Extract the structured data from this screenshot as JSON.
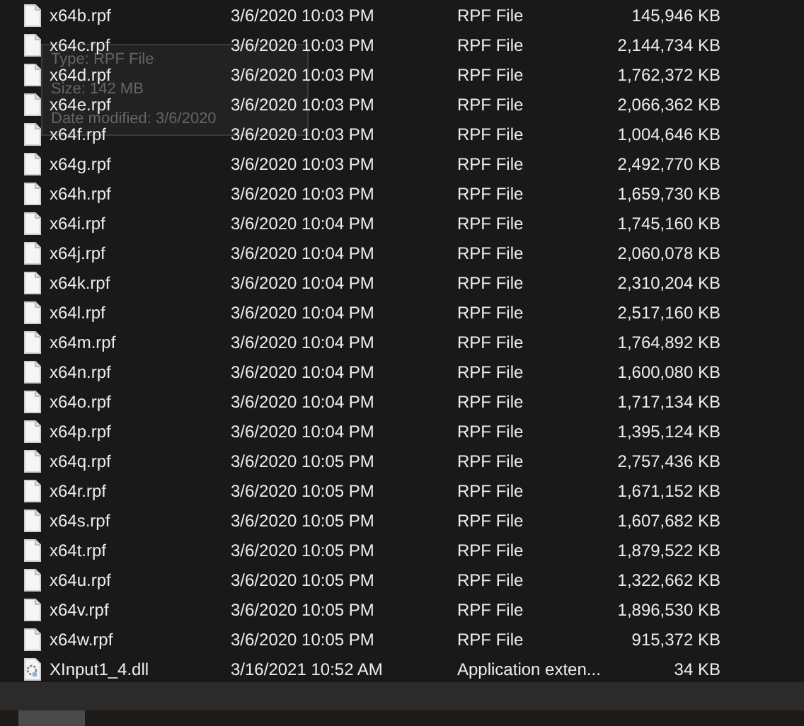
{
  "files": [
    {
      "name": "x64b.rpf",
      "kind": "file",
      "date": "3/6/2020 10:03 PM",
      "type": "RPF File",
      "size": "145,946 KB"
    },
    {
      "name": "x64c.rpf",
      "kind": "file",
      "date": "3/6/2020 10:03 PM",
      "type": "RPF File",
      "size": "2,144,734 KB"
    },
    {
      "name": "x64d.rpf",
      "kind": "file",
      "date": "3/6/2020 10:03 PM",
      "type": "RPF File",
      "size": "1,762,372 KB"
    },
    {
      "name": "x64e.rpf",
      "kind": "file",
      "date": "3/6/2020 10:03 PM",
      "type": "RPF File",
      "size": "2,066,362 KB"
    },
    {
      "name": "x64f.rpf",
      "kind": "file",
      "date": "3/6/2020 10:03 PM",
      "type": "RPF File",
      "size": "1,004,646 KB"
    },
    {
      "name": "x64g.rpf",
      "kind": "file",
      "date": "3/6/2020 10:03 PM",
      "type": "RPF File",
      "size": "2,492,770 KB"
    },
    {
      "name": "x64h.rpf",
      "kind": "file",
      "date": "3/6/2020 10:03 PM",
      "type": "RPF File",
      "size": "1,659,730 KB"
    },
    {
      "name": "x64i.rpf",
      "kind": "file",
      "date": "3/6/2020 10:04 PM",
      "type": "RPF File",
      "size": "1,745,160 KB"
    },
    {
      "name": "x64j.rpf",
      "kind": "file",
      "date": "3/6/2020 10:04 PM",
      "type": "RPF File",
      "size": "2,060,078 KB"
    },
    {
      "name": "x64k.rpf",
      "kind": "file",
      "date": "3/6/2020 10:04 PM",
      "type": "RPF File",
      "size": "2,310,204 KB"
    },
    {
      "name": "x64l.rpf",
      "kind": "file",
      "date": "3/6/2020 10:04 PM",
      "type": "RPF File",
      "size": "2,517,160 KB"
    },
    {
      "name": "x64m.rpf",
      "kind": "file",
      "date": "3/6/2020 10:04 PM",
      "type": "RPF File",
      "size": "1,764,892 KB"
    },
    {
      "name": "x64n.rpf",
      "kind": "file",
      "date": "3/6/2020 10:04 PM",
      "type": "RPF File",
      "size": "1,600,080 KB"
    },
    {
      "name": "x64o.rpf",
      "kind": "file",
      "date": "3/6/2020 10:04 PM",
      "type": "RPF File",
      "size": "1,717,134 KB"
    },
    {
      "name": "x64p.rpf",
      "kind": "file",
      "date": "3/6/2020 10:04 PM",
      "type": "RPF File",
      "size": "1,395,124 KB"
    },
    {
      "name": "x64q.rpf",
      "kind": "file",
      "date": "3/6/2020 10:05 PM",
      "type": "RPF File",
      "size": "2,757,436 KB"
    },
    {
      "name": "x64r.rpf",
      "kind": "file",
      "date": "3/6/2020 10:05 PM",
      "type": "RPF File",
      "size": "1,671,152 KB"
    },
    {
      "name": "x64s.rpf",
      "kind": "file",
      "date": "3/6/2020 10:05 PM",
      "type": "RPF File",
      "size": "1,607,682 KB"
    },
    {
      "name": "x64t.rpf",
      "kind": "file",
      "date": "3/6/2020 10:05 PM",
      "type": "RPF File",
      "size": "1,879,522 KB"
    },
    {
      "name": "x64u.rpf",
      "kind": "file",
      "date": "3/6/2020 10:05 PM",
      "type": "RPF File",
      "size": "1,322,662 KB"
    },
    {
      "name": "x64v.rpf",
      "kind": "file",
      "date": "3/6/2020 10:05 PM",
      "type": "RPF File",
      "size": "1,896,530 KB"
    },
    {
      "name": "x64w.rpf",
      "kind": "file",
      "date": "3/6/2020 10:05 PM",
      "type": "RPF File",
      "size": "915,372 KB"
    },
    {
      "name": "XInput1_4.dll",
      "kind": "dll",
      "date": "3/16/2021 10:52 AM",
      "type": "Application exten...",
      "size": "34 KB"
    }
  ],
  "tooltip": {
    "lines": [
      "Type: RPF File",
      "Size: 142 MB",
      "Date modified: 3/6/2020"
    ]
  }
}
